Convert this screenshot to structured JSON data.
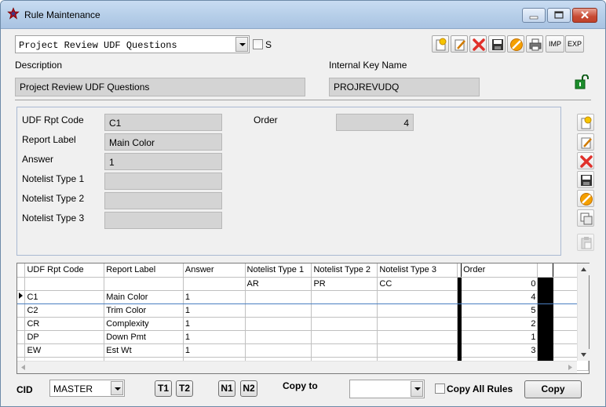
{
  "window": {
    "title": "Rule Maintenance"
  },
  "header": {
    "rule_select": {
      "value": "Project Review UDF Questions"
    },
    "s_checkbox": {
      "label": "S",
      "checked": false
    },
    "description": {
      "label": "Description",
      "value": "Project Review UDF Questions"
    },
    "internal_key": {
      "label": "Internal Key Name",
      "value": "PROJREVUDQ"
    },
    "toolbar": {
      "imp_label": "IMP",
      "exp_label": "EXP"
    }
  },
  "detail": {
    "udf_rpt_code": {
      "label": "UDF Rpt Code",
      "value": "C1"
    },
    "order": {
      "label": "Order",
      "value": "4"
    },
    "report_label": {
      "label": "Report Label",
      "value": "Main Color"
    },
    "answer": {
      "label": "Answer",
      "value": "1"
    },
    "notelist1": {
      "label": "Notelist Type 1",
      "value": ""
    },
    "notelist2": {
      "label": "Notelist Type 2",
      "value": ""
    },
    "notelist3": {
      "label": "Notelist Type 3",
      "value": ""
    }
  },
  "grid": {
    "columns": [
      "UDF Rpt Code",
      "Report Label",
      "Answer",
      "Notelist Type 1",
      "Notelist Type 2",
      "Notelist Type 3",
      "Order"
    ],
    "rows": [
      [
        "",
        "",
        "",
        "AR",
        "PR",
        "CC",
        "0"
      ],
      [
        "C1",
        "Main Color",
        "1",
        "",
        "",
        "",
        "4"
      ],
      [
        "C2",
        "Trim Color",
        "1",
        "",
        "",
        "",
        "5"
      ],
      [
        "CR",
        "Complexity",
        "1",
        "",
        "",
        "",
        "2"
      ],
      [
        "DP",
        "Down Pmt",
        "1",
        "",
        "",
        "",
        "1"
      ],
      [
        "EW",
        "Est Wt",
        "1",
        "",
        "",
        "",
        "3"
      ]
    ]
  },
  "footer": {
    "cid_label": "CID",
    "cid_value": "MASTER",
    "t1": "T1",
    "t2": "T2",
    "n1": "N1",
    "n2": "N2",
    "copy_to_label": "Copy to",
    "copy_to_value": "",
    "copy_all_rules_label": "Copy All Rules",
    "copy_button": "Copy"
  },
  "colors": {
    "title_gradient_top": "#c9dcf2",
    "field_bg": "#d4d4d4",
    "close_red": "#c74a33"
  }
}
